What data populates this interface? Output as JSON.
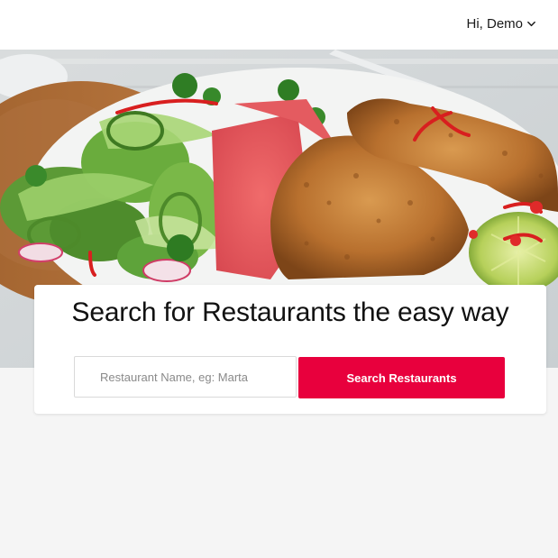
{
  "header": {
    "user_greeting": "Hi, Demo",
    "menu_icon": "chevron-down-icon"
  },
  "hero": {
    "image": "food-photo"
  },
  "search": {
    "title": "Search for Restaurants the easy way",
    "input_value": "",
    "input_placeholder": "Restaurant Name, eg: Marta",
    "button_label": "Search Restaurants"
  },
  "colors": {
    "accent": "#e8003d",
    "page_background": "#f5f5f5",
    "card_background": "#ffffff"
  }
}
